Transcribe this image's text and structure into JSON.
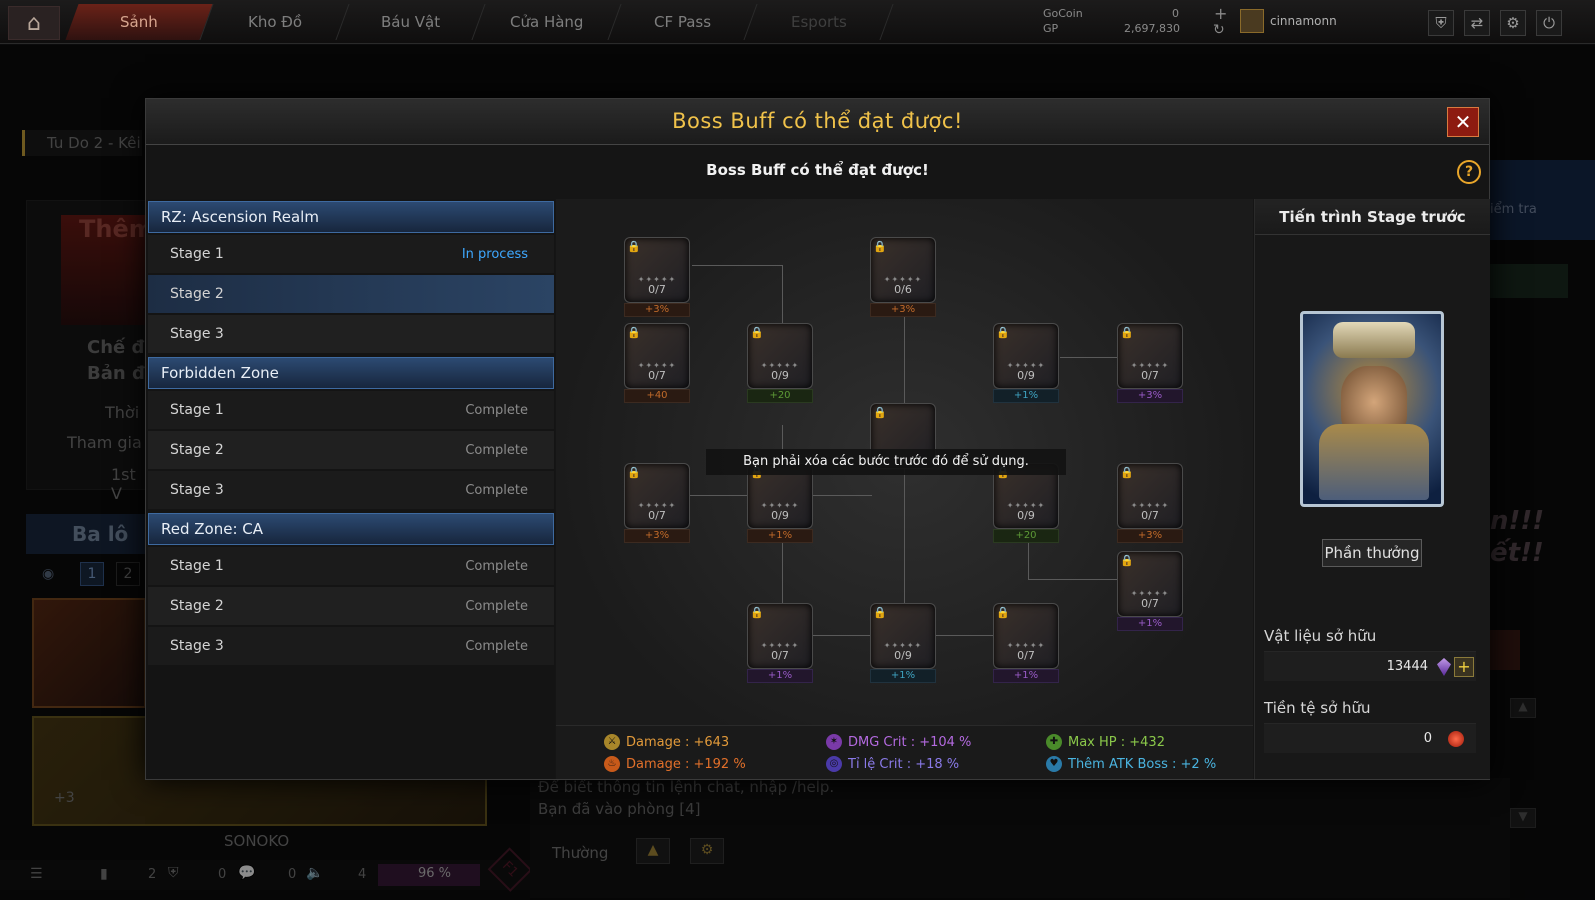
{
  "topnav": {
    "tabs": [
      "Sảnh",
      "Kho Đồ",
      "Báu Vật",
      "Cửa Hàng",
      "CF Pass",
      "Esports"
    ],
    "gocoin_label": "GoCoin",
    "gocoin_value": "0",
    "gp_label": "GP",
    "gp_value": "2,697,830",
    "username": "cinnamonn"
  },
  "background": {
    "room_title": "Tu Do 2 - Kêi",
    "banner_text": "Thêm",
    "mode_line1": "Chế đ",
    "mode_line2": "Bản đ",
    "time_label": "Thời",
    "join_label": "Tham gia",
    "place_label": "1st V",
    "backpack_label": "Ba lô",
    "page1": "1",
    "page2": "2",
    "plus_count": "+3",
    "char_name": "SONOKO",
    "chat_line1": "Để biết thông tin lệnh chat, nhập /help.",
    "chat_line2": "Bạn đã vào phòng [4]",
    "chat_mode": "Thường",
    "right_hint": "iểm tra",
    "stat_a": "2",
    "stat_b": "0",
    "stat_c": "0",
    "stat_d": "4",
    "percent": "96 %",
    "f1": "F1",
    "banner_right": "n!!!",
    "banner_right2": "ết!!"
  },
  "modal": {
    "title": "Boss Buff có thể đạt được!",
    "subtitle": "Boss Buff có thể đạt được!",
    "close": "✕",
    "help": "?",
    "groups": [
      {
        "name": "RZ: Ascension Realm",
        "stages": [
          {
            "label": "Stage 1",
            "status": "In process"
          },
          {
            "label": "Stage 2",
            "status": ""
          },
          {
            "label": "Stage 3",
            "status": ""
          }
        ]
      },
      {
        "name": "Forbidden Zone",
        "stages": [
          {
            "label": "Stage 1",
            "status": "Complete"
          },
          {
            "label": "Stage 2",
            "status": "Complete"
          },
          {
            "label": "Stage 3",
            "status": "Complete"
          }
        ]
      },
      {
        "name": "Red Zone: CA",
        "stages": [
          {
            "label": "Stage 1",
            "status": "Complete"
          },
          {
            "label": "Stage 2",
            "status": "Complete"
          },
          {
            "label": "Stage 3",
            "status": "Complete"
          }
        ]
      }
    ],
    "tree_nodes": [
      {
        "count": "0/7",
        "bonus": "+3%",
        "kind": "orange"
      },
      {
        "count": "0/6",
        "bonus": "+3%",
        "kind": "orange"
      },
      {
        "count": "0/7",
        "bonus": "+40",
        "kind": "orange"
      },
      {
        "count": "0/9",
        "bonus": "+20",
        "kind": "green"
      },
      {
        "count": "0/9",
        "bonus": "+1%",
        "kind": "blue"
      },
      {
        "count": "0/7",
        "bonus": "+3%",
        "kind": "purple"
      },
      {
        "count": "",
        "bonus": "",
        "kind": "orange"
      },
      {
        "count": "0/7",
        "bonus": "+3%",
        "kind": "orange"
      },
      {
        "count": "0/9",
        "bonus": "+1%",
        "kind": "orange"
      },
      {
        "count": "0/9",
        "bonus": "+20",
        "kind": "green"
      },
      {
        "count": "0/7",
        "bonus": "+3%",
        "kind": "orange"
      },
      {
        "count": "0/7",
        "bonus": "+1%",
        "kind": "purple"
      },
      {
        "count": "0/7",
        "bonus": "+1%",
        "kind": "purple"
      },
      {
        "count": "0/9",
        "bonus": "+1%",
        "kind": "blue"
      },
      {
        "count": "0/7",
        "bonus": "+1%",
        "kind": "purple"
      }
    ],
    "tooltip": "Bạn phải xóa các bước trước đó để sử dụng.",
    "stats": [
      {
        "text": "Damage : +643",
        "color": "#e29a3a"
      },
      {
        "text": "Damage : +192 %",
        "color": "#e2702a"
      },
      {
        "text": "DMG Crit : +104 %",
        "color": "#b46ae0"
      },
      {
        "text": "Tỉ lệ Crit : +18 %",
        "color": "#8a7ae8"
      },
      {
        "text": "Max HP : +432",
        "color": "#8ac84a"
      },
      {
        "text": "Thêm ATK Boss : +2 %",
        "color": "#4ab4e0"
      }
    ],
    "right": {
      "header": "Tiến trình Stage trước",
      "reward_button": "Phần thưởng",
      "materials_label": "Vật liệu sở hữu",
      "materials_value": "13444",
      "currency_label": "Tiền tệ sở hữu",
      "currency_value": "0"
    }
  },
  "colors": {
    "accent": "#f0c24a",
    "close_bg": "#8d1b10",
    "group_bg": "#2c4a72",
    "process": "#3ea8ff"
  }
}
